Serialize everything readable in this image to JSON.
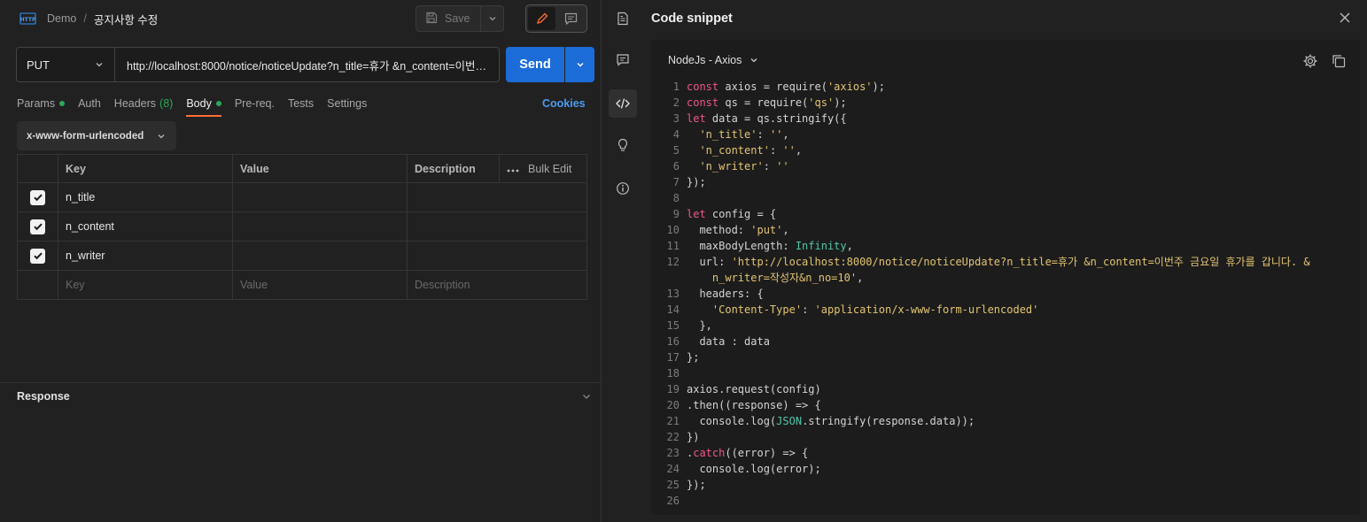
{
  "breadcrumb": {
    "workspace": "Demo",
    "separator": "/",
    "request_name": "공지사항 수정"
  },
  "toolbar": {
    "save_label": "Save"
  },
  "request": {
    "method": "PUT",
    "url": "http://localhost:8000/notice/noticeUpdate?n_title=휴가 &n_content=이번주 금요일 휴가를 갑니다. &n_writer=작성자&n_no=10",
    "send_label": "Send"
  },
  "tabs": [
    {
      "label": "Params",
      "dot": true
    },
    {
      "label": "Auth"
    },
    {
      "label": "Headers",
      "count": "(8)"
    },
    {
      "label": "Body",
      "dot": true,
      "active": true
    },
    {
      "label": "Pre-req."
    },
    {
      "label": "Tests"
    },
    {
      "label": "Settings"
    }
  ],
  "cookies_label": "Cookies",
  "body_type": "x-www-form-urlencoded",
  "table": {
    "headers": {
      "key": "Key",
      "value": "Value",
      "description": "Description",
      "bulk_edit": "Bulk Edit"
    },
    "rows": [
      {
        "key": "n_title",
        "value": "",
        "description": "",
        "checked": true
      },
      {
        "key": "n_content",
        "value": "",
        "description": "",
        "checked": true
      },
      {
        "key": "n_writer",
        "value": "",
        "description": "",
        "checked": true
      }
    ],
    "placeholder": {
      "key": "Key",
      "value": "Value",
      "description": "Description"
    }
  },
  "response_label": "Response",
  "snippet": {
    "title": "Code snippet",
    "language": "NodeJs - Axios",
    "lines": [
      {
        "n": "1",
        "t": [
          [
            "k",
            "const"
          ],
          [
            "p",
            " axios = require("
          ],
          [
            "s",
            "'axios'"
          ],
          [
            "p",
            ");"
          ]
        ]
      },
      {
        "n": "2",
        "t": [
          [
            "k",
            "const"
          ],
          [
            "p",
            " qs = require("
          ],
          [
            "s",
            "'qs'"
          ],
          [
            "p",
            ");"
          ]
        ]
      },
      {
        "n": "3",
        "t": [
          [
            "k",
            "let"
          ],
          [
            "p",
            " data = qs.stringify({"
          ]
        ]
      },
      {
        "n": "4",
        "t": [
          [
            "p",
            "  "
          ],
          [
            "s",
            "'n_title'"
          ],
          [
            "p",
            ": "
          ],
          [
            "s",
            "''"
          ],
          [
            "p",
            ","
          ]
        ]
      },
      {
        "n": "5",
        "t": [
          [
            "p",
            "  "
          ],
          [
            "s",
            "'n_content'"
          ],
          [
            "p",
            ": "
          ],
          [
            "s",
            "''"
          ],
          [
            "p",
            ","
          ]
        ]
      },
      {
        "n": "6",
        "t": [
          [
            "p",
            "  "
          ],
          [
            "s",
            "'n_writer'"
          ],
          [
            "p",
            ": "
          ],
          [
            "s",
            "''"
          ]
        ]
      },
      {
        "n": "7",
        "t": [
          [
            "p",
            "});"
          ]
        ]
      },
      {
        "n": "8",
        "t": []
      },
      {
        "n": "9",
        "t": [
          [
            "k",
            "let"
          ],
          [
            "p",
            " config = {"
          ]
        ]
      },
      {
        "n": "10",
        "t": [
          [
            "p",
            "  method: "
          ],
          [
            "s",
            "'put'"
          ],
          [
            "p",
            ","
          ]
        ]
      },
      {
        "n": "11",
        "t": [
          [
            "p",
            "  maxBodyLength: "
          ],
          [
            "n",
            "Infinity"
          ],
          [
            "p",
            ","
          ]
        ]
      },
      {
        "n": "12",
        "t": [
          [
            "p",
            "  url: "
          ],
          [
            "s",
            "'http://localhost:8000/notice/noticeUpdate?n_title=휴가 &n_content=이번주 금요일 휴가를 갑니다. &"
          ]
        ]
      },
      {
        "n": "",
        "t": [
          [
            "s",
            "    n_writer=작성자&n_no=10'"
          ],
          [
            "p",
            ","
          ]
        ]
      },
      {
        "n": "13",
        "t": [
          [
            "p",
            "  headers: {"
          ]
        ]
      },
      {
        "n": "14",
        "t": [
          [
            "p",
            "    "
          ],
          [
            "s",
            "'Content-Type'"
          ],
          [
            "p",
            ": "
          ],
          [
            "s",
            "'application/x-www-form-urlencoded'"
          ]
        ]
      },
      {
        "n": "15",
        "t": [
          [
            "p",
            "  },"
          ]
        ]
      },
      {
        "n": "16",
        "t": [
          [
            "p",
            "  data : data"
          ]
        ]
      },
      {
        "n": "17",
        "t": [
          [
            "p",
            "};"
          ]
        ]
      },
      {
        "n": "18",
        "t": []
      },
      {
        "n": "19",
        "t": [
          [
            "p",
            "axios.request(config)"
          ]
        ]
      },
      {
        "n": "20",
        "t": [
          [
            "p",
            ".then((response) => {"
          ]
        ]
      },
      {
        "n": "21",
        "t": [
          [
            "p",
            "  console.log("
          ],
          [
            "n",
            "JSON"
          ],
          [
            "p",
            ".stringify(response.data));"
          ]
        ]
      },
      {
        "n": "22",
        "t": [
          [
            "p",
            "})"
          ]
        ]
      },
      {
        "n": "23",
        "t": [
          [
            "p",
            "."
          ],
          [
            "k",
            "catch"
          ],
          [
            "p",
            "((error) => {"
          ]
        ]
      },
      {
        "n": "24",
        "t": [
          [
            "p",
            "  console.log(error);"
          ]
        ]
      },
      {
        "n": "25",
        "t": [
          [
            "p",
            "});"
          ]
        ]
      },
      {
        "n": "26",
        "t": []
      }
    ]
  },
  "colors": {
    "send": "#1c6cd8",
    "active_tab_underline": "#ff6c37",
    "dot": "#2aa85a",
    "link": "#4c9bf0"
  },
  "icons": [
    "http-icon",
    "save-icon",
    "pencil-icon",
    "comment-icon",
    "document-icon",
    "code-icon",
    "lightbulb-icon",
    "info-icon",
    "close-icon",
    "gear-icon",
    "copy-icon"
  ]
}
